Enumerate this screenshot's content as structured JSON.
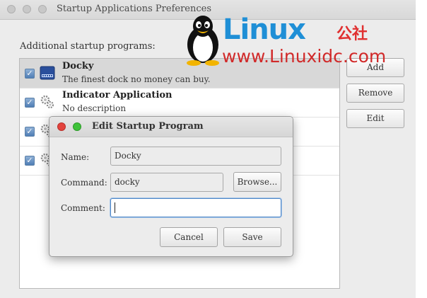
{
  "window": {
    "title": "Startup Applications Preferences",
    "section_label": "Additional startup programs:"
  },
  "programs": [
    {
      "title": "Docky",
      "subtitle": "The finest dock no money can buy.",
      "checked": true,
      "icon": "docky-icon"
    },
    {
      "title": "Indicator Application",
      "subtitle": "No description",
      "checked": true,
      "icon": "gears-icon"
    },
    {
      "title": "",
      "subtitle": "",
      "checked": true,
      "icon": "gears-icon"
    },
    {
      "title": "",
      "subtitle": "",
      "checked": true,
      "icon": "gears-icon"
    }
  ],
  "side_buttons": {
    "add": "Add",
    "remove": "Remove",
    "edit": "Edit"
  },
  "watermark": {
    "brand": "Linux",
    "brand_cn": "公社",
    "url": "www.Linuxidc.com"
  },
  "dialog": {
    "title": "Edit Startup Program",
    "name_label": "Name:",
    "name_value": "Docky",
    "command_label": "Command:",
    "command_value": "docky",
    "browse_label": "Browse...",
    "comment_label": "Comment:",
    "comment_value": "",
    "cancel_label": "Cancel",
    "save_label": "Save"
  },
  "colors": {
    "checkbox": "#4f7eb5",
    "close": "#e3433d",
    "maximize": "#3fc23a",
    "focus": "#4f87c7",
    "watermark_blue": "#1f8fd6",
    "watermark_red": "#d12a2a"
  }
}
